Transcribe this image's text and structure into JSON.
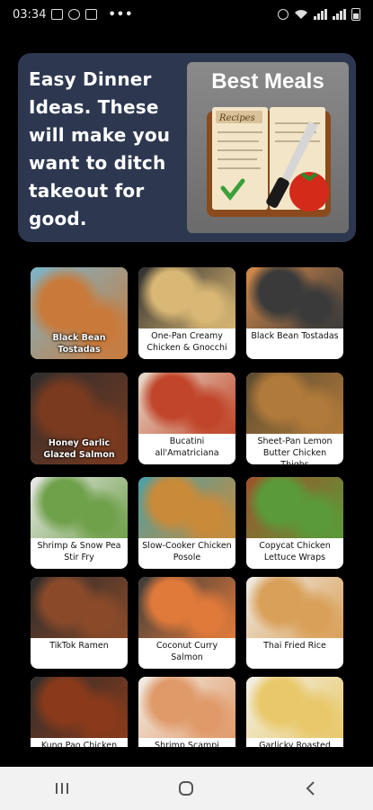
{
  "status": {
    "time": "03:34",
    "more": "•••"
  },
  "banner": {
    "text_lines": [
      "Easy Dinner",
      "Ideas. These",
      "will make you",
      "want to ditch",
      "takeout for",
      "good."
    ],
    "art_title": "Best Meals",
    "book_cover_text": "Recipes"
  },
  "recipes": [
    {
      "label": "Black Bean Tostadas",
      "style": "overlay",
      "colors": [
        "#c97a3a",
        "#7eb4c8"
      ]
    },
    {
      "label": "One-Pan Creamy Chicken & Gnocchi",
      "style": "below",
      "colors": [
        "#d9b774",
        "#2d2d2d"
      ]
    },
    {
      "label": "Black Bean Tostadas",
      "style": "below",
      "colors": [
        "#3a3a3a",
        "#d98c4a"
      ]
    },
    {
      "label": "Honey Garlic Glazed Salmon",
      "style": "overlay",
      "colors": [
        "#7a3a1f",
        "#2e2e2e"
      ]
    },
    {
      "label": "Bucatini all'Amatriciana",
      "style": "below",
      "colors": [
        "#c0452a",
        "#e8dccb"
      ]
    },
    {
      "label": "Sheet-Pan Lemon Butter Chicken Thighs",
      "style": "below",
      "colors": [
        "#b07a3a",
        "#5a4a30"
      ]
    },
    {
      "label": "Shrimp & Snow Pea Stir Fry",
      "style": "below",
      "colors": [
        "#6fa04a",
        "#e9e9e9"
      ]
    },
    {
      "label": "Slow-Cooker Chicken Posole",
      "style": "below",
      "colors": [
        "#c98a3a",
        "#4aa0a8"
      ]
    },
    {
      "label": "Copycat Chicken Lettuce Wraps",
      "style": "below",
      "colors": [
        "#5a9a3a",
        "#a0502a"
      ]
    },
    {
      "label": "TikTok Ramen",
      "style": "below",
      "colors": [
        "#8a4a2a",
        "#2a2a2a"
      ]
    },
    {
      "label": "Coconut Curry Salmon",
      "style": "below",
      "colors": [
        "#e07a3a",
        "#3a3a3a"
      ]
    },
    {
      "label": "Thai Fried Rice",
      "style": "below",
      "colors": [
        "#d9a05a",
        "#f0ece4"
      ]
    },
    {
      "label": "Kung Pao Chicken",
      "style": "below",
      "colors": [
        "#8a3a1a",
        "#2e2e2e"
      ]
    },
    {
      "label": "Shrimp Scampi",
      "style": "below",
      "colors": [
        "#e09a6a",
        "#f2efe8"
      ]
    },
    {
      "label": "Garlicky Roasted",
      "style": "below",
      "colors": [
        "#e8c86a",
        "#f4f1ea"
      ]
    }
  ],
  "nav": {
    "recents_icon": "recents-icon",
    "home_icon": "home-icon",
    "back_icon": "back-icon"
  }
}
